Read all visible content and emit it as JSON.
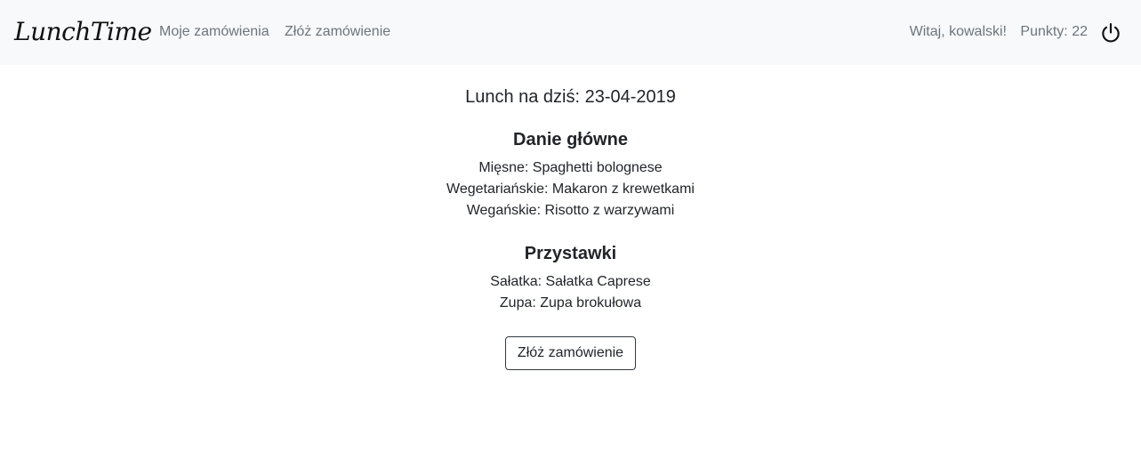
{
  "navbar": {
    "brand": "LunchTime",
    "links": {
      "my_orders": "Moje zamówienia",
      "place_order": "Złóż zamówienie"
    },
    "greeting": "Witaj, kowalski!",
    "points": "Punkty: 22",
    "logout_icon": "power-icon"
  },
  "main": {
    "date_line": "Lunch na dziś: 23-04-2019",
    "sections": [
      {
        "title": "Danie główne",
        "items": [
          "Mięsne: Spaghetti bolognese",
          "Wegetariańskie: Makaron z krewetkami",
          "Wegańskie: Risotto z warzywami"
        ]
      },
      {
        "title": "Przystawki",
        "items": [
          "Sałatka: Sałatka Caprese",
          "Zupa: Zupa brokułowa"
        ]
      }
    ],
    "order_button": "Złóż zamówienie"
  }
}
